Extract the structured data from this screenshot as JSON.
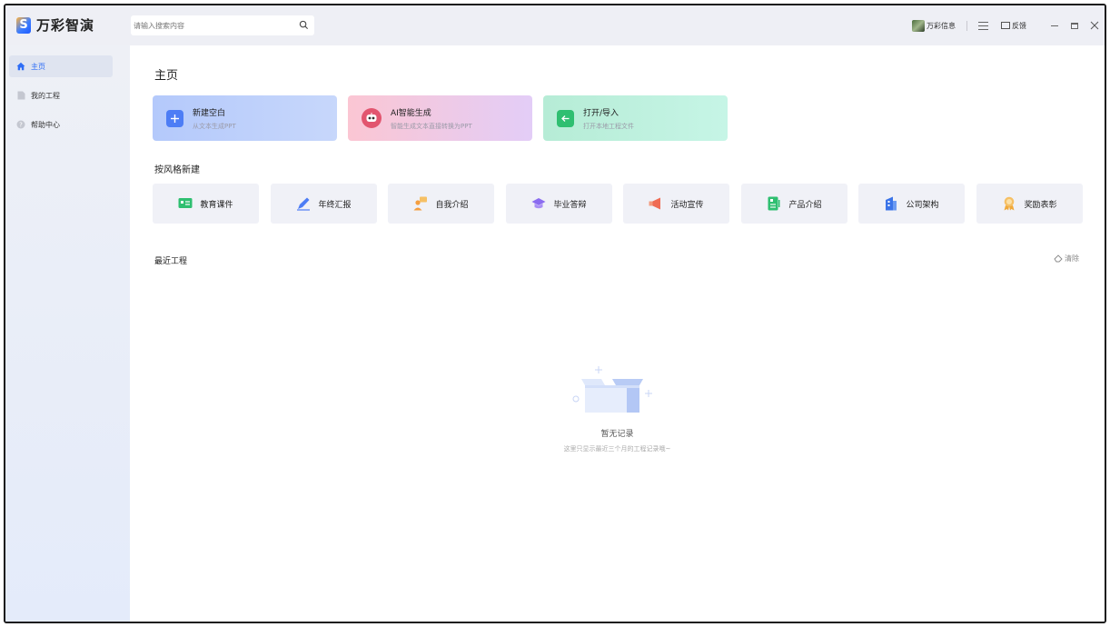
{
  "app": {
    "logo_char": "S",
    "name": "万彩智演"
  },
  "search": {
    "placeholder": "请输入搜索内容"
  },
  "topbar": {
    "user_name": "万彩信息",
    "feedback_label": "反馈"
  },
  "sidebar": {
    "items": [
      {
        "label": "主页",
        "icon": "home-icon",
        "active": true
      },
      {
        "label": "我的工程",
        "icon": "file-icon",
        "active": false
      },
      {
        "label": "帮助中心",
        "icon": "help-icon",
        "active": false
      }
    ]
  },
  "main": {
    "title": "主页",
    "actions": [
      {
        "title": "新建空白",
        "subtitle": "从文本生成PPT",
        "icon": "plus-icon",
        "icon_color": "#4d7df5"
      },
      {
        "title": "AI智能生成",
        "subtitle": "智能生成文本直接转换为PPT",
        "icon": "robot-icon",
        "icon_color": "#e2556f"
      },
      {
        "title": "打开/导入",
        "subtitle": "打开本地工程文件",
        "icon": "arrow-left-icon",
        "icon_color": "#2fbf71"
      }
    ],
    "style_section_title": "按风格新建",
    "styles": [
      {
        "label": "教育课件",
        "icon": "teaching-board-icon"
      },
      {
        "label": "年终汇报",
        "icon": "pen-icon"
      },
      {
        "label": "自我介绍",
        "icon": "person-speech-icon"
      },
      {
        "label": "毕业答辩",
        "icon": "graduation-cap-icon"
      },
      {
        "label": "活动宣传",
        "icon": "megaphone-icon"
      },
      {
        "label": "产品介绍",
        "icon": "product-sheet-icon"
      },
      {
        "label": "公司架构",
        "icon": "building-icon"
      },
      {
        "label": "奖励表彰",
        "icon": "medal-icon"
      }
    ],
    "recent_title": "最近工程",
    "clear_label": "清除",
    "empty_title": "暂无记录",
    "empty_subtitle": "这里只显示最近三个月的工程记录哦~"
  },
  "colors": {
    "accent": "#2e6df6",
    "sidebar_bg": "#eef0f6",
    "card_bg": "#f0f1f7"
  }
}
